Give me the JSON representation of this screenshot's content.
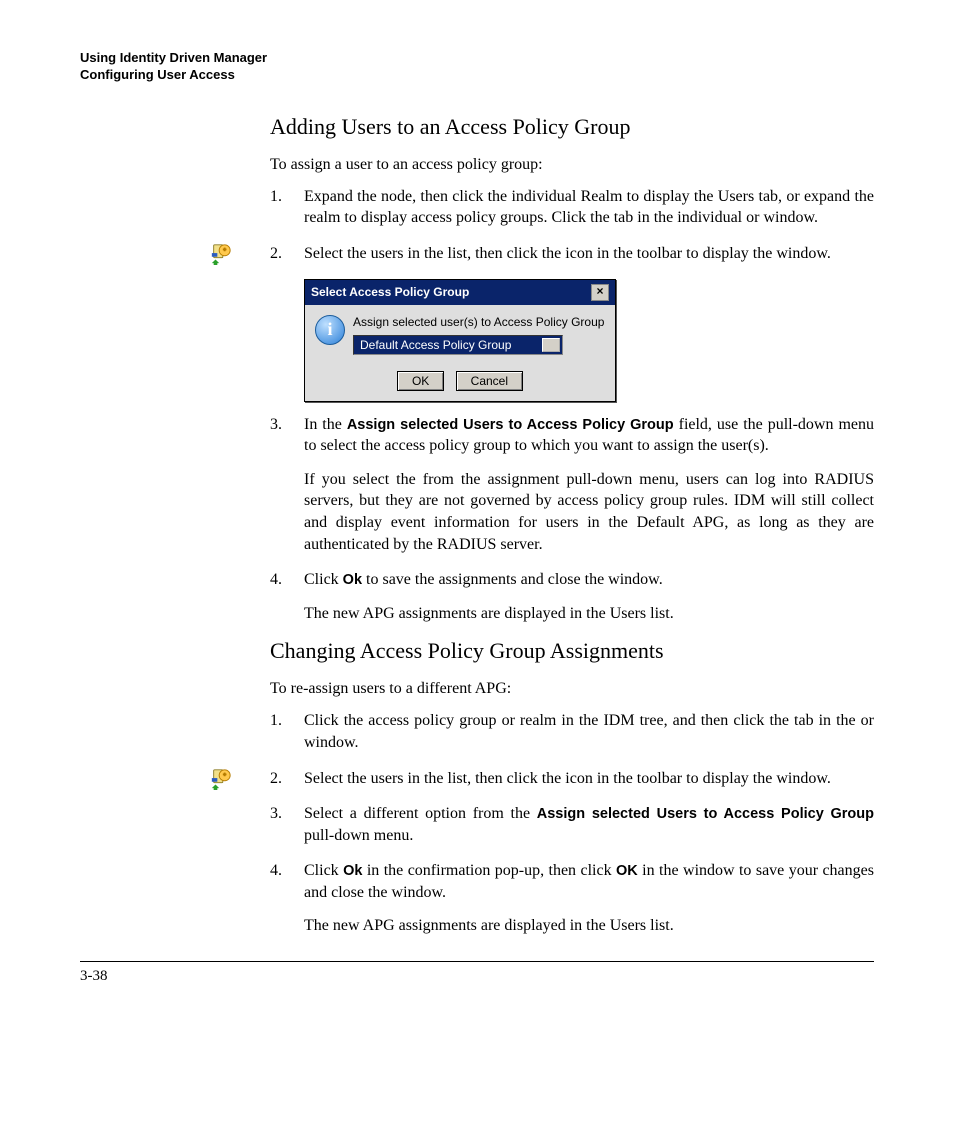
{
  "header": {
    "line1": "Using Identity Driven Manager",
    "line2": "Configuring User Access"
  },
  "sectionA": {
    "title": "Adding Users to an Access Policy Group",
    "intro": "To assign a user to an access policy group:",
    "step1": "Expand the             node, then click the individual Realm to display the Users tab, or expand the realm to display access policy groups. Click the           tab in the individual           or                             window.",
    "step2": "Select the users in the list, then click the                         icon in the toolbar to display the                                             window.",
    "step3_prefix": "In the ",
    "step3_bold": "Assign selected Users to Access Policy Group",
    "step3_suffix": "  field, use the pull-down menu to select the access policy group to which you want to assign the user(s).",
    "step3_sub": "If you select the                                               from the assignment pull-down menu, users can log into RADIUS servers, but they are not governed by access policy group rules. IDM will still collect and display event informa­tion for users in the Default APG, as long as they are authenticated by the RADIUS server.",
    "step4_prefix": "Click ",
    "step4_bold": "Ok",
    "step4_suffix": " to save the assignments and close the window.",
    "step4_sub": "The new APG assignments are displayed in the Users list."
  },
  "dialog": {
    "title": "Select Access Policy Group",
    "label": "Assign selected user(s) to Access Policy Group",
    "selected": "Default Access Policy Group",
    "ok": "OK",
    "cancel": "Cancel",
    "close": "×"
  },
  "sectionB": {
    "title": "Changing Access Policy Group Assignments",
    "intro": "To re-assign users to a different APG:",
    "step1": "Click the access policy group or realm in the IDM tree, and then click the           tab in the                                  or            window.",
    "step2": "Select the users in the list, then click the                         icon in the toolbar to display the                                             window.",
    "step3_prefix": "Select a different option from the ",
    "step3_bold": "Assign selected Users to Access Policy Group",
    "step3_suffix": " pull-down menu.",
    "step4_a": "Click ",
    "step4_b": "Ok",
    "step4_c": " in the confirmation pop-up, then click ",
    "step4_d": "OK",
    "step4_e": " in the                         window to save your changes and close the window.",
    "step4_sub": "The new APG assignments are displayed in the Users list."
  },
  "page_number": "3-38"
}
